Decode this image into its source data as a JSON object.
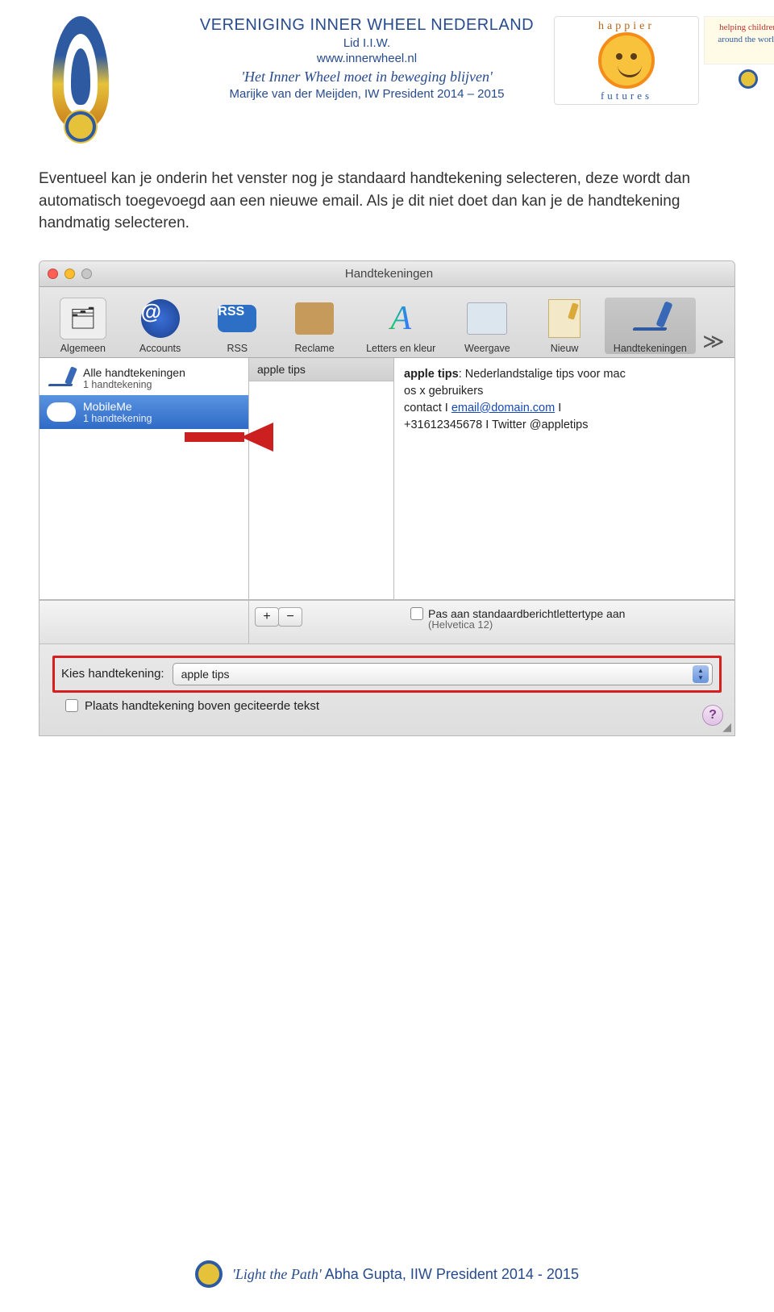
{
  "header": {
    "org_title": "VERENIGING INNER WHEEL NEDERLAND",
    "sub1": "Lid I.I.W.",
    "sub2": "www.innerwheel.nl",
    "motto": "'Het Inner Wheel moet in beweging blijven'",
    "president_line": "Marijke van der Meijden, IW President 2014 – 2015",
    "happier_top": "happier",
    "happier_bottom": "futures",
    "helping1": "helping children",
    "helping2": "around the world"
  },
  "body": {
    "paragraph": "Eventueel kan je onderin het venster nog je standaard handtekening selecteren, deze wordt dan automatisch toegevoegd aan een nieuwe email. Als je dit niet doet dan kan je de handtekening handmatig selecteren."
  },
  "window": {
    "title": "Handtekeningen",
    "toolbar": {
      "algemeen": "Algemeen",
      "accounts": "Accounts",
      "rss": "RSS",
      "reclame": "Reclame",
      "letters": "Letters en kleur",
      "weergave": "Weergave",
      "nieuw": "Nieuw",
      "handtekeningen": "Handtekeningen",
      "overflow": "≫"
    },
    "accounts_pane": {
      "all_title": "Alle handtekeningen",
      "all_sub": "1 handtekening",
      "mm_title": "MobileMe",
      "mm_sub": "1 handtekening"
    },
    "sig_list": {
      "item1": "apple tips"
    },
    "preview": {
      "line1a": "apple tips",
      "line1b": ": Nederlandstalige tips voor mac",
      "line2": "os x gebruikers",
      "line3a": "contact I ",
      "line3_link": "email@domain.com",
      "line3b": " I",
      "line4": "+31612345678 I Twitter @appletips"
    },
    "add_label": "+",
    "remove_label": "−",
    "font_checkbox": "Pas aan standaardberichtlettertype aan",
    "font_name": "(Helvetica 12)",
    "kies_label": "Kies handtekening:",
    "kies_value": "apple tips",
    "place_above": "Plaats handtekening boven geciteerde tekst",
    "help": "?"
  },
  "footer": {
    "motto": "'Light the Path'",
    "rest": " Abha Gupta, IIW President 2014 - 2015"
  }
}
